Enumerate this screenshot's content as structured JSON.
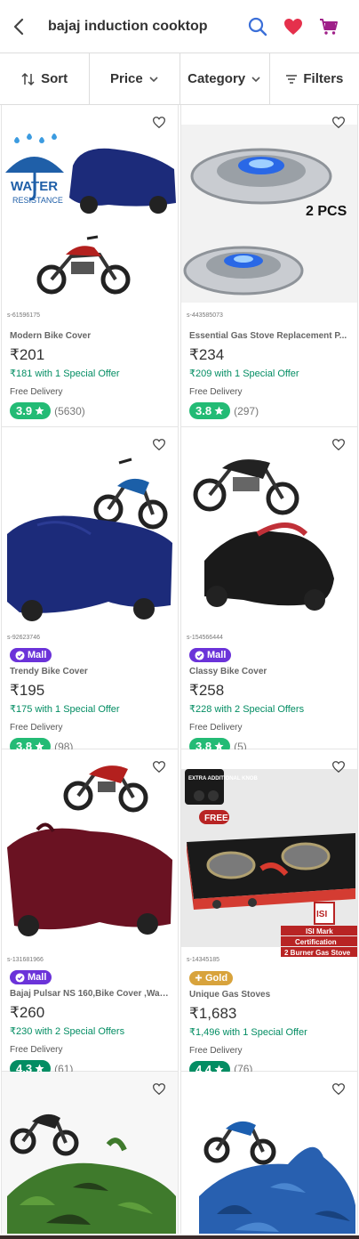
{
  "header": {
    "search_text": "bajaj induction cooktop"
  },
  "toolbar": {
    "sort": "Sort",
    "price": "Price",
    "category": "Category",
    "filters": "Filters"
  },
  "colors": {
    "accent": "#9f2089",
    "rating_green": "#23bb75",
    "rating_dark": "#038d63",
    "mall": "#6b33d9",
    "gold": "#d8a33c"
  },
  "products": [
    {
      "name": "Modern Bike Cover",
      "price": "₹201",
      "offer": "₹181 with 1 Special Offer",
      "delivery": "Free Delivery",
      "rating": "3.9",
      "reviews": "(5630)",
      "code": "s-61596175"
    },
    {
      "name": "Essential Gas Stove Replacement P...",
      "price": "₹234",
      "offer": "₹209 with 1 Special Offer",
      "delivery": "Free Delivery",
      "rating": "3.8",
      "reviews": "(297)",
      "code": "s-443585073",
      "img_text": "2 PCS"
    },
    {
      "badge": "Mall",
      "name": "Trendy Bike Cover",
      "price": "₹195",
      "offer": "₹175 with 1 Special Offer",
      "delivery": "Free Delivery",
      "rating": "3.8",
      "reviews": "(98)",
      "code": "s-92623746"
    },
    {
      "badge": "Mall",
      "name": "Classy Bike Cover",
      "price": "₹258",
      "offer": "₹228 with 2 Special Offers",
      "delivery": "Free Delivery",
      "rating": "3.8",
      "reviews": "(5)",
      "code": "s-154566444"
    },
    {
      "badge": "Mall",
      "name": "Bajaj Pulsar NS 160,Bike Cover ,Wate...",
      "price": "₹260",
      "offer": "₹230 with 2 Special Offers",
      "delivery": "Free Delivery",
      "rating": "4.3",
      "reviews": "(61)",
      "code": "s-131681966"
    },
    {
      "badge": "Gold",
      "name": "Unique Gas Stoves",
      "price": "₹1,683",
      "offer": "₹1,496 with 1 Special Offer",
      "delivery": "Free Delivery",
      "rating": "4.4",
      "reviews": "(76)",
      "code": "s-14345185",
      "img_text": {
        "extra": "EXTRA ADDITIONAL KNOB",
        "free": "FREE",
        "isi": "ISI",
        "isi_mark": "ISI Mark",
        "cert": "Certification",
        "burner": "2 Burner Gas Stove"
      }
    },
    {},
    {}
  ]
}
